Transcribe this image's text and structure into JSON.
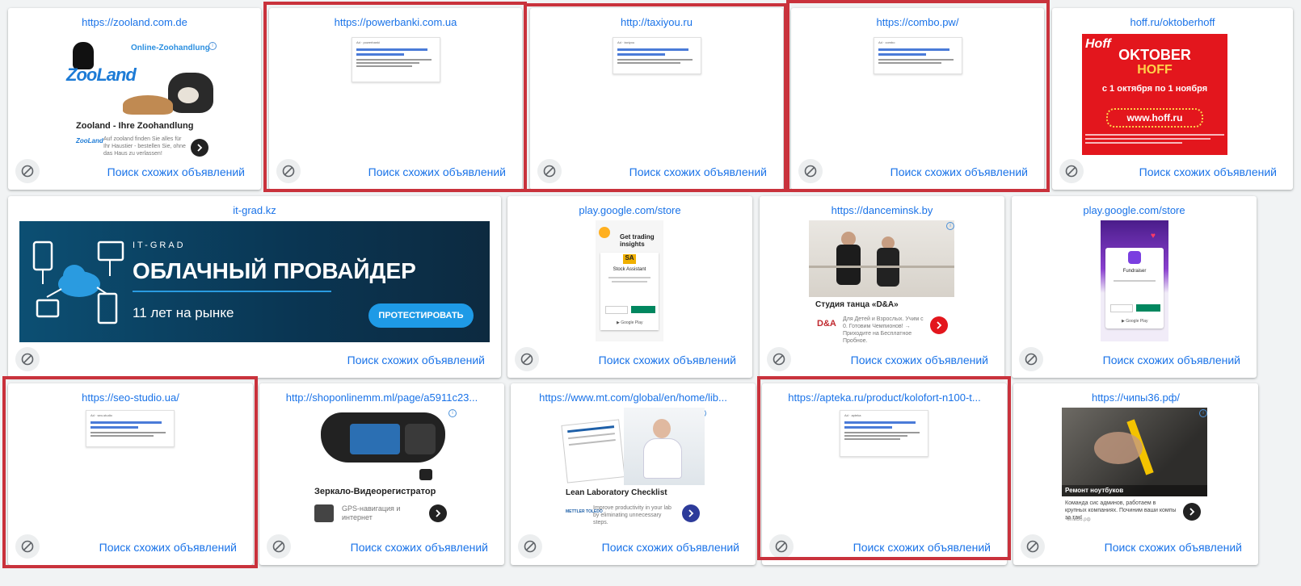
{
  "common": {
    "similar_label": "Поиск схожих объявлений"
  },
  "cards": [
    {
      "url": "https://zooland.com.de"
    },
    {
      "url": "https://powerbanki.com.ua"
    },
    {
      "url": "http://taxiyou.ru"
    },
    {
      "url": "https://combo.pw/"
    },
    {
      "url": "hoff.ru/oktoberhoff"
    },
    {
      "url": "it-grad.kz"
    },
    {
      "url": "play.google.com/store"
    },
    {
      "url": "https://danceminsk.by"
    },
    {
      "url": "play.google.com/store"
    },
    {
      "url": "https://seo-studio.ua/"
    },
    {
      "url": "http://shoponlinemm.ml/page/a5911c23..."
    },
    {
      "url": "https://www.mt.com/global/en/home/lib..."
    },
    {
      "url": "https://apteka.ru/product/kolofort-n100-t..."
    },
    {
      "url": "https://чипы36.рф/"
    }
  ],
  "ads": {
    "zooland": {
      "brand_online": "Online-Zoohandlung",
      "logo_text": "ZooLand",
      "title": "Zooland - Ihre Zoohandlung",
      "desc": "Auf zooland finden Sie alles für Ihr Haustier - bestellen Sie, ohne das Haus zu verlassen!"
    },
    "hoff": {
      "logo": "Hoff",
      "line1": "OKTOBER",
      "line2": "HOFF",
      "dates": "с 1 октября по 1 ноября",
      "site": "www.hoff.ru"
    },
    "itgrad": {
      "brand": "IT-GRAD",
      "headline": "ОБЛАЧНЫЙ ПРОВАЙДЕР",
      "sub": "11 лет на рынке",
      "cta": "ПРОТЕСТИРОВАТЬ"
    },
    "trading": {
      "title": "Get trading insights",
      "badge": "SA",
      "name": "Stock Assistant"
    },
    "dance": {
      "title": "Студия танца «D&A»",
      "logo": "D&A",
      "desc": "Для Детей и Взрослых. Учим с 0. Готовим Чемпионов! → Приходите на Бесплатное Пробное."
    },
    "app2": {
      "name": "Fundraiser"
    },
    "mirror": {
      "title": "Зеркало-Видеорегистратор",
      "desc": "GPS-навигация и интернет"
    },
    "lean": {
      "title": "Lean Laboratory Checklist",
      "brand": "METTLER TOLEDO",
      "desc": "Improve productivity in your lab by eliminating unnecessary steps."
    },
    "chips": {
      "overlay": "Ремонт ноутбуков",
      "desc": "Команда сис админов, работаем в крупных компаниях. Починим ваши компы за так!",
      "src": "Чипы36.рф"
    }
  }
}
